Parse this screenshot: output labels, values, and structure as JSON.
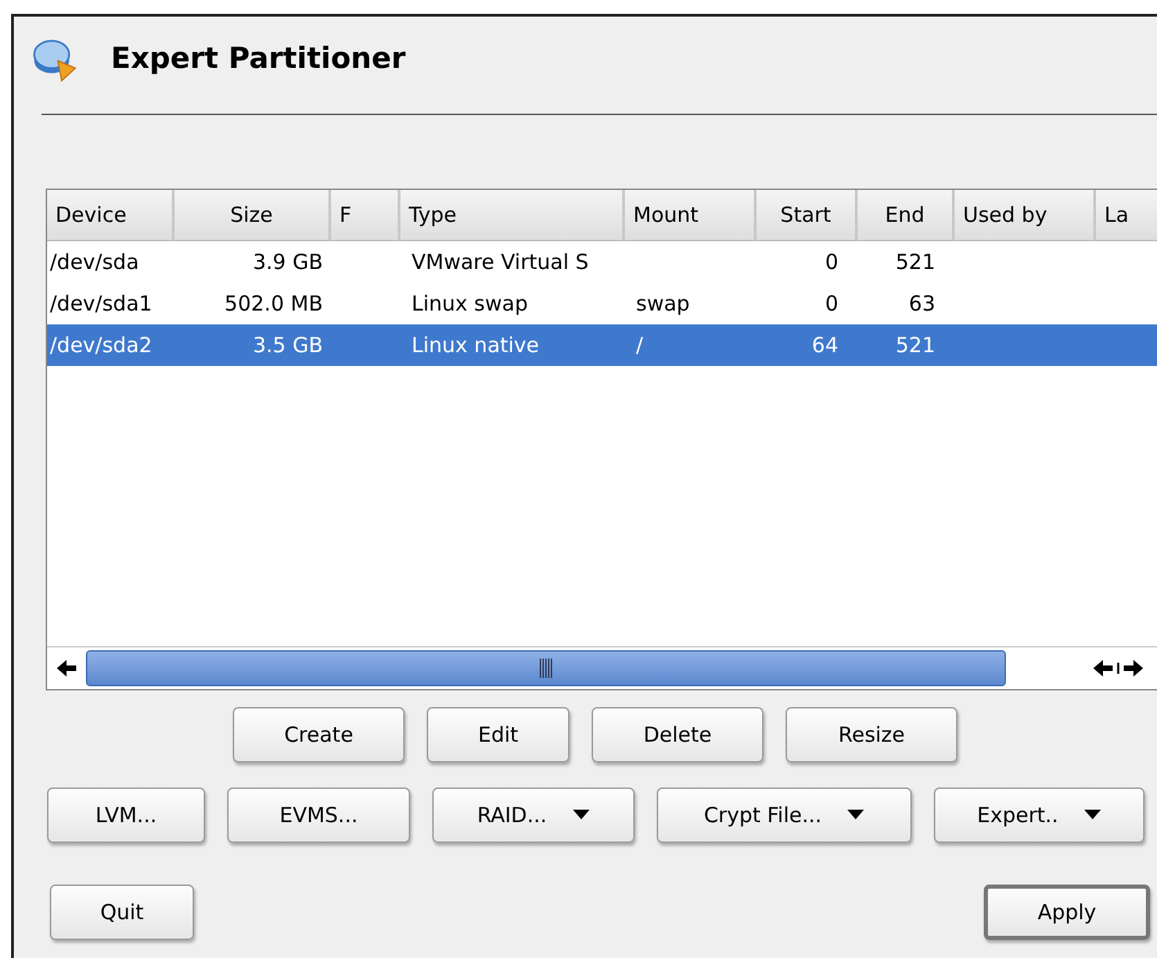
{
  "window": {
    "title": "Expert Partitioner"
  },
  "table": {
    "columns": [
      "Device",
      "Size",
      "F",
      "Type",
      "Mount",
      "Start",
      "End",
      "Used by",
      "La"
    ],
    "rows": [
      {
        "selected": false,
        "cells": [
          "/dev/sda",
          "3.9 GB",
          "",
          "VMware Virtual S",
          "",
          "0",
          "521",
          "",
          ""
        ]
      },
      {
        "selected": false,
        "cells": [
          "/dev/sda1",
          "502.0 MB",
          "",
          "Linux swap",
          "swap",
          "0",
          "63",
          "",
          ""
        ]
      },
      {
        "selected": true,
        "cells": [
          "/dev/sda2",
          "3.5 GB",
          "",
          "Linux native",
          "/",
          "64",
          "521",
          "",
          ""
        ]
      }
    ]
  },
  "action_buttons": [
    {
      "label": "Create"
    },
    {
      "label": "Edit"
    },
    {
      "label": "Delete"
    },
    {
      "label": "Resize"
    }
  ],
  "tool_buttons": [
    {
      "label": "LVM...",
      "dropdown": false
    },
    {
      "label": "EVMS...",
      "dropdown": false
    },
    {
      "label": "RAID...",
      "dropdown": true
    },
    {
      "label": "Crypt File...",
      "dropdown": true
    },
    {
      "label": "Expert..",
      "dropdown": true
    }
  ],
  "quit_button": {
    "label": "Quit"
  },
  "apply_button": {
    "label": "Apply",
    "default": true
  }
}
